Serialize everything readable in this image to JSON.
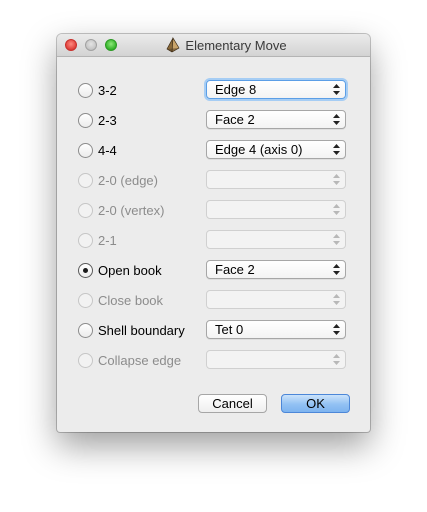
{
  "window": {
    "title": "Elementary Move",
    "controls": [
      "close",
      "minimize",
      "zoom"
    ]
  },
  "moves": [
    {
      "label": "3-2",
      "enabled": true,
      "selected": false,
      "option": "Edge 8",
      "focused": true
    },
    {
      "label": "2-3",
      "enabled": true,
      "selected": false,
      "option": "Face 2",
      "focused": false
    },
    {
      "label": "4-4",
      "enabled": true,
      "selected": false,
      "option": "Edge 4 (axis 0)",
      "focused": false
    },
    {
      "label": "2-0 (edge)",
      "enabled": false,
      "selected": false,
      "option": "",
      "focused": false
    },
    {
      "label": "2-0 (vertex)",
      "enabled": false,
      "selected": false,
      "option": "",
      "focused": false
    },
    {
      "label": "2-1",
      "enabled": false,
      "selected": false,
      "option": "",
      "focused": false
    },
    {
      "label": "Open book",
      "enabled": true,
      "selected": true,
      "option": "Face 2",
      "focused": false
    },
    {
      "label": "Close book",
      "enabled": false,
      "selected": false,
      "option": "",
      "focused": false
    },
    {
      "label": "Shell boundary",
      "enabled": true,
      "selected": false,
      "option": "Tet 0",
      "focused": false
    },
    {
      "label": "Collapse edge",
      "enabled": false,
      "selected": false,
      "option": "",
      "focused": false
    }
  ],
  "buttons": {
    "cancel": "Cancel",
    "ok": "OK"
  },
  "icons": {
    "app": "tetrahedron-icon",
    "popup": "up-down-chevrons-icon"
  },
  "colors": {
    "window_bg": "#ececec",
    "focus_ring": "#a6cdf4",
    "default_button": "#92c1f3",
    "disabled_text": "#8c8c8c"
  }
}
